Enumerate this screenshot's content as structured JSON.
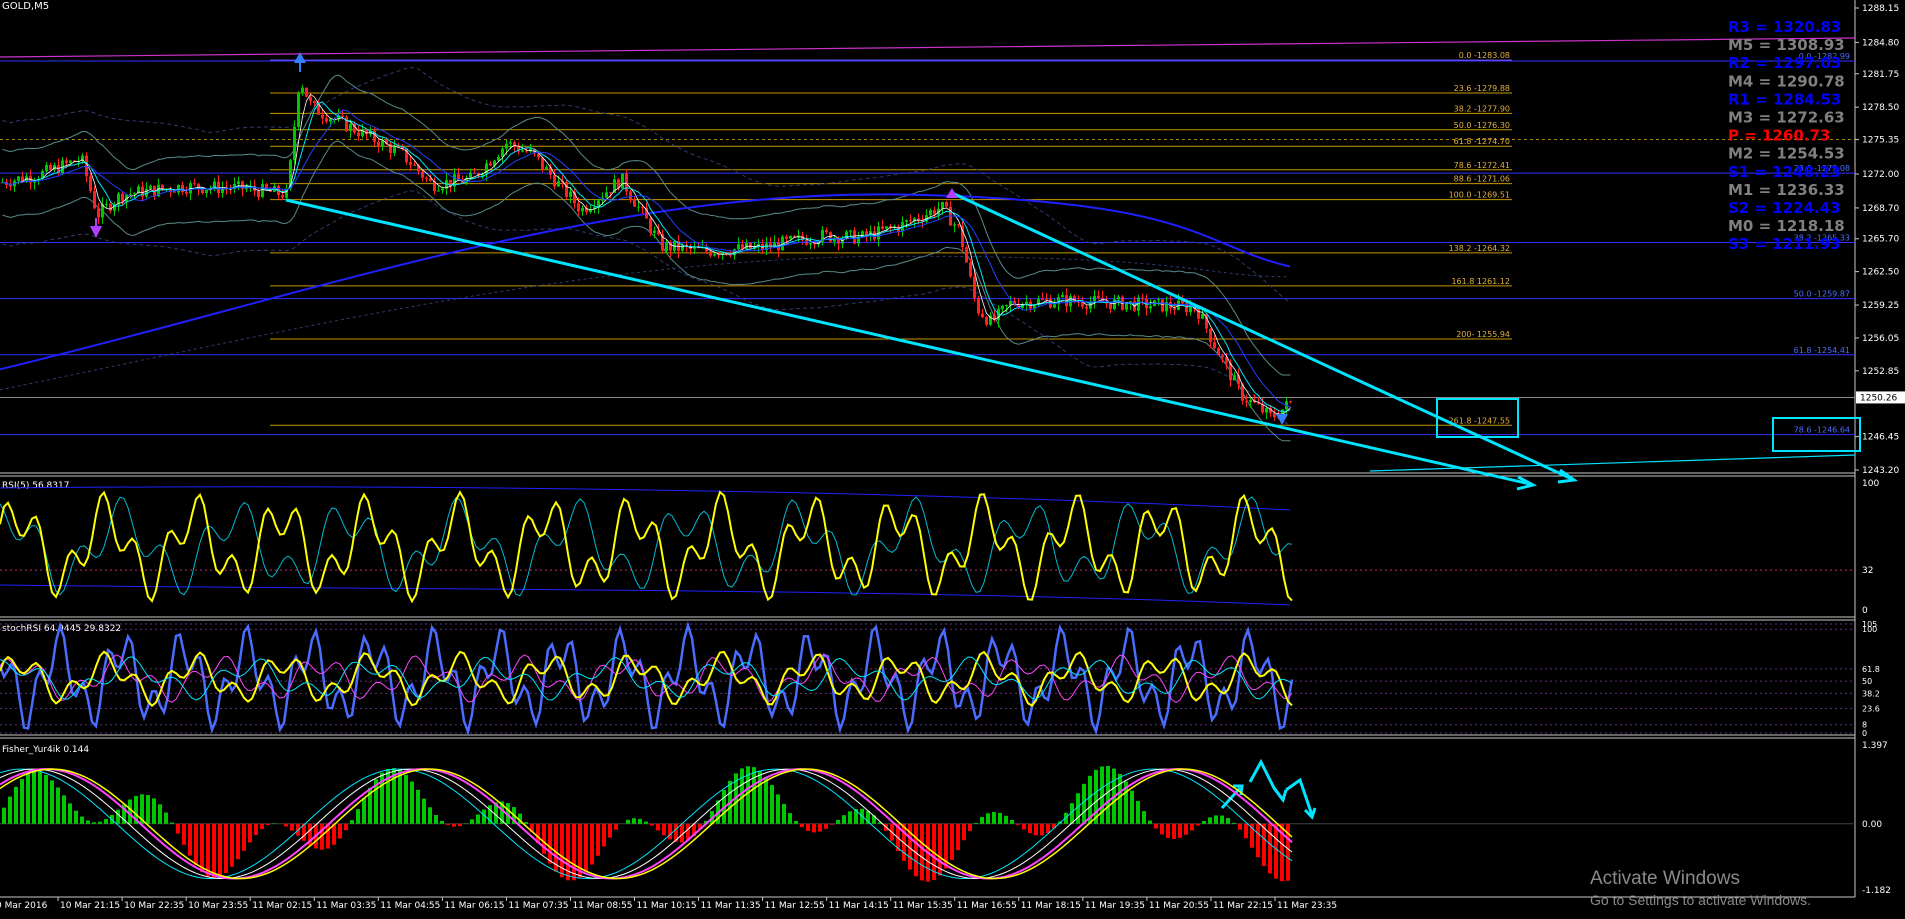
{
  "window": {
    "symbol_title": "GOLD,M5"
  },
  "main_scale": [
    "1288.15",
    "1284.80",
    "1281.75",
    "1278.50",
    "1275.35",
    "1272.00",
    "1268.70",
    "1265.70",
    "1262.50",
    "1259.25",
    "1256.05",
    "1252.85",
    "1250.26",
    "1246.45",
    "1243.20"
  ],
  "pivots": [
    {
      "text": "R3 = 1320.83",
      "color": "#0000ff"
    },
    {
      "text": "M5 = 1308.93",
      "color": "#808080"
    },
    {
      "text": "R2 = 1297.03",
      "color": "#0000ff"
    },
    {
      "text": "M4 = 1290.78",
      "color": "#808080"
    },
    {
      "text": "R1 = 1284.53",
      "color": "#0000ff"
    },
    {
      "text": "M3 = 1272.63",
      "color": "#808080"
    },
    {
      "text": "P = 1260.73",
      "color": "#ff0000"
    },
    {
      "text": "M2 = 1254.53",
      "color": "#808080"
    },
    {
      "text": "S1 = 1248.23",
      "color": "#0000ff"
    },
    {
      "text": "M1 = 1236.33",
      "color": "#808080"
    },
    {
      "text": "S2 = 1224.43",
      "color": "#0000ff"
    },
    {
      "text": "M0 = 1218.18",
      "color": "#808080"
    },
    {
      "text": "S3 = 1211.93",
      "color": "#0000ff"
    }
  ],
  "fib_left": [
    "0.0 -1283.08",
    "23.6 -1279.88",
    "38.2 -1277.90",
    "50.0 -1276.30",
    "61.8 -1274.70",
    "78.6 -1272.41",
    "88.6 -1271.06",
    "100.0 -1269.51",
    "138.2 -1264.32",
    "161.8 1261.12",
    "200- 1255.94",
    "261.8 -1247.55"
  ],
  "fib_right": [
    "0.0 -1282.99",
    "38.2 -1265.33",
    "50.0 -1259.87",
    "61.8 -1254.41",
    "78.6 -1246.64"
  ],
  "fib_right_partial": "23.6 -1272.08",
  "rsi": {
    "label": "RSI(5) 56.8317",
    "scale": [
      "100",
      "32",
      "0"
    ]
  },
  "stoch": {
    "label": "stochRSI 64.9445 29.8322",
    "scale": [
      "105",
      "100",
      "61.8",
      "50",
      "38.2",
      "23.6",
      "8",
      "0"
    ]
  },
  "fisher": {
    "label": "Fisher_Yur4ik 0.144",
    "scale": [
      "1.397",
      "0.00",
      "-1.182"
    ]
  },
  "time_axis": [
    "0 Mar 2016",
    "10 Mar 21:15",
    "10 Mar 22:35",
    "10 Mar 23:55",
    "11 Mar 02:15",
    "11 Mar 03:35",
    "11 Mar 04:55",
    "11 Mar 06:15",
    "11 Mar 07:35",
    "11 Mar 08:55",
    "11 Mar 10:15",
    "11 Mar 11:35",
    "11 Mar 12:55",
    "11 Mar 14:15",
    "11 Mar 15:35",
    "11 Mar 16:55",
    "11 Mar 18:15",
    "11 Mar 19:35",
    "11 Mar 20:55",
    "11 Mar 22:15",
    "11 Mar 23:35"
  ],
  "watermark": {
    "line1": "Activate Windows",
    "line2": "Go to Settings to activate Windows."
  },
  "colors": {
    "bull": "#00c800",
    "bear": "#ff2020",
    "wedge": "#00e5ff",
    "fib": "#c89600",
    "blue_line": "#2020ff",
    "magenta": "#cc33cc"
  },
  "chart_data": [
    {
      "type": "candlestick",
      "title": "GOLD,M5",
      "ylim": [
        1243.2,
        1288.15
      ],
      "x": [
        "10 Mar 20:00",
        "10 Mar 21:15",
        "10 Mar 22:35",
        "10 Mar 23:55",
        "11 Mar 02:15",
        "11 Mar 02:30",
        "11 Mar 03:35",
        "11 Mar 04:55",
        "11 Mar 06:15",
        "11 Mar 07:35",
        "11 Mar 08:55",
        "11 Mar 10:15",
        "11 Mar 11:35",
        "11 Mar 12:55",
        "11 Mar 14:15",
        "11 Mar 15:35",
        "11 Mar 16:55",
        "11 Mar 18:15",
        "11 Mar 19:35",
        "11 Mar 20:55",
        "11 Mar 22:15",
        "11 Mar 23:00",
        "11 Mar 23:35"
      ],
      "close": [
        1271.5,
        1269.0,
        1270.5,
        1270.2,
        1270.0,
        1283.0,
        1277.5,
        1271.5,
        1273.0,
        1275.0,
        1268.5,
        1265.0,
        1264.8,
        1265.5,
        1266.2,
        1268.0,
        1257.5,
        1259.5,
        1259.2,
        1259.0,
        1250.5,
        1248.0,
        1250.2
      ],
      "wedge_lines": [
        {
          "from": [
            "11 Mar 02:15",
            1269.5
          ],
          "to": [
            "11 Mar 23:35",
            1247.0
          ]
        },
        {
          "from": [
            "11 Mar 16:55",
            1271.0
          ],
          "to": [
            "11 Mar 23:35",
            1253.0
          ]
        }
      ]
    },
    {
      "type": "line",
      "title": "RSI(5) 56.8317",
      "ylim": [
        0,
        100
      ],
      "levels": [
        32
      ],
      "last": 56.83
    },
    {
      "type": "line",
      "title": "stochRSI 64.9445 29.8322",
      "ylim": [
        0,
        105
      ],
      "levels": [
        8,
        23.6,
        38.2,
        50,
        61.8,
        100
      ],
      "last": [
        64.94,
        29.83
      ]
    },
    {
      "type": "bar",
      "title": "Fisher_Yur4ik 0.144",
      "ylim": [
        -1.182,
        1.397
      ],
      "last": 0.144
    }
  ]
}
